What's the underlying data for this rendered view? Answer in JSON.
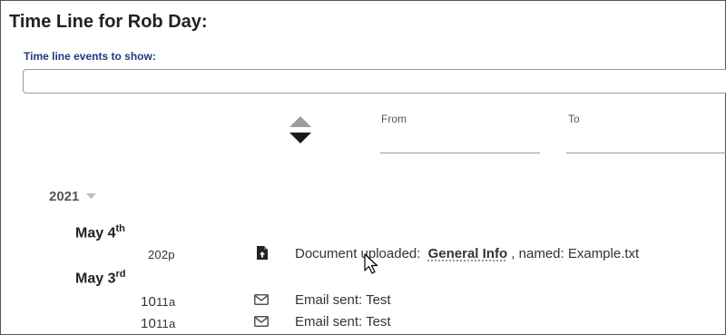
{
  "title": "Time Line for Rob Day:",
  "filters": {
    "events_label": "Time line events to show:",
    "events_value": "",
    "from_label": "From",
    "to_label": "To",
    "from_value": "",
    "to_value": ""
  },
  "timeline": {
    "year": "2021",
    "days": [
      {
        "month_day": "May 4",
        "suffix": "th",
        "events": [
          {
            "time": "202p",
            "icon": "document-upload-icon",
            "text": "Document uploaded:",
            "link": "General Info",
            "trailing": " , named: Example.txt"
          }
        ]
      },
      {
        "month_day": "May 3",
        "suffix": "rd",
        "events": [
          {
            "time": "10",
            "time_suffix": "11a",
            "icon": "envelope-icon",
            "text": "Email sent: Test"
          },
          {
            "time": "10",
            "time_suffix": "11a",
            "icon": "envelope-icon",
            "text": "Email sent: Test"
          }
        ]
      }
    ]
  },
  "colors": {
    "label_blue": "#1f3a7a",
    "border": "#9a9a9a",
    "sort_active": "#1a1a1a",
    "sort_inactive": "#9c9c9c"
  }
}
